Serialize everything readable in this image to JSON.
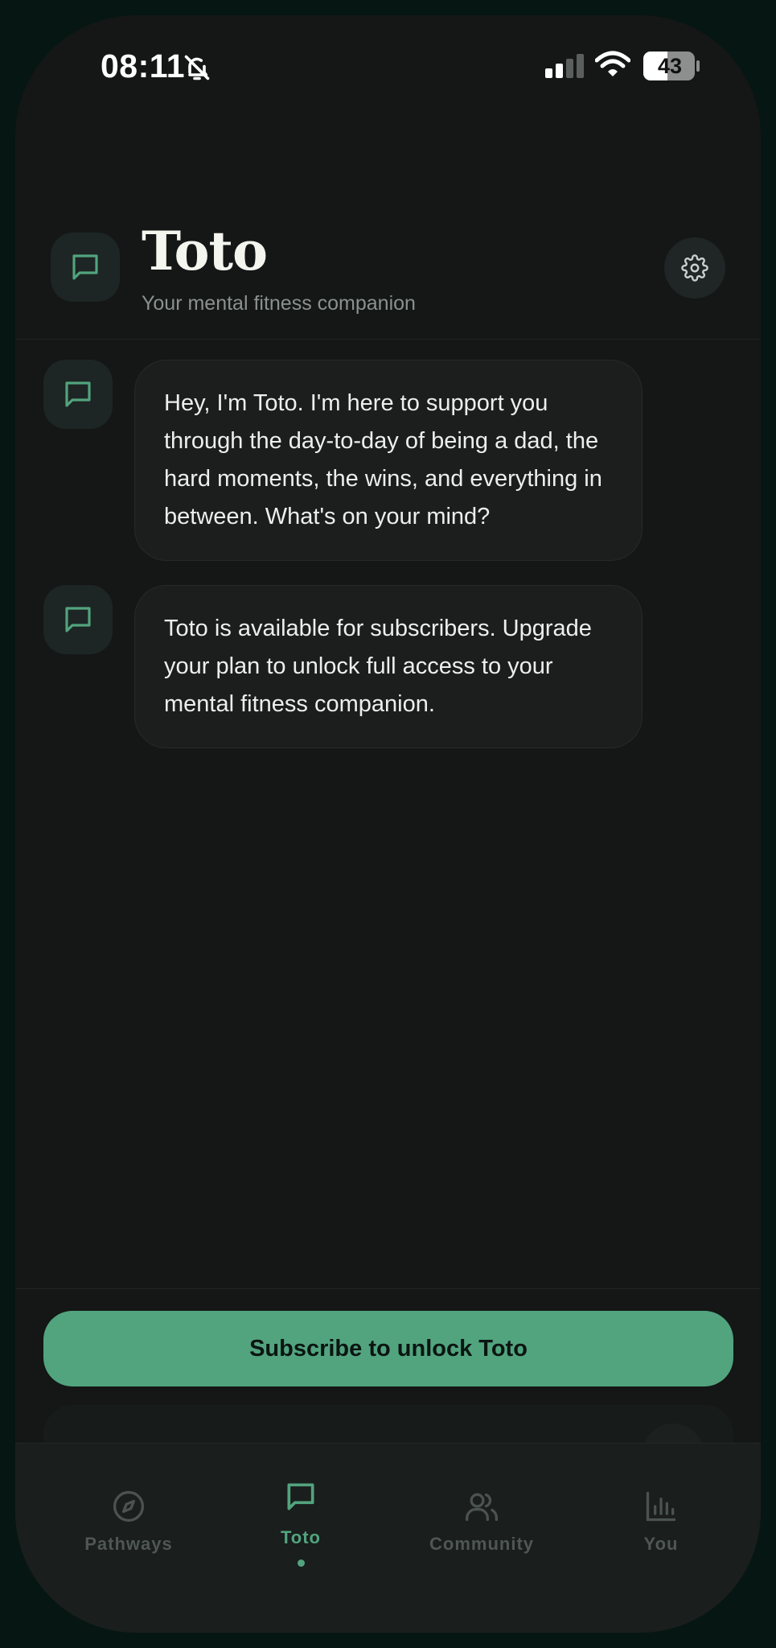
{
  "status_bar": {
    "time": "08:11",
    "battery": "43"
  },
  "header": {
    "title": "Toto",
    "subtitle": "Your mental fitness companion"
  },
  "messages": [
    {
      "text": "Hey, I'm Toto. I'm here to support you through the day-to-day of being a dad, the hard moments, the wins, and everything in between. What's on your mind?"
    },
    {
      "text": "Toto is available for subscribers. Upgrade your plan to unlock full access to your mental fitness companion."
    }
  ],
  "subscribe_label": "Subscribe to unlock Toto",
  "tabs": [
    {
      "label": "Pathways",
      "icon": "compass-icon"
    },
    {
      "label": "Toto",
      "icon": "chat-icon",
      "active": true
    },
    {
      "label": "Community",
      "icon": "users-icon"
    },
    {
      "label": "You",
      "icon": "bar-chart-icon"
    }
  ],
  "colors": {
    "accent": "#52a47e",
    "background": "#141716",
    "bubble": "#1b1e1d"
  }
}
